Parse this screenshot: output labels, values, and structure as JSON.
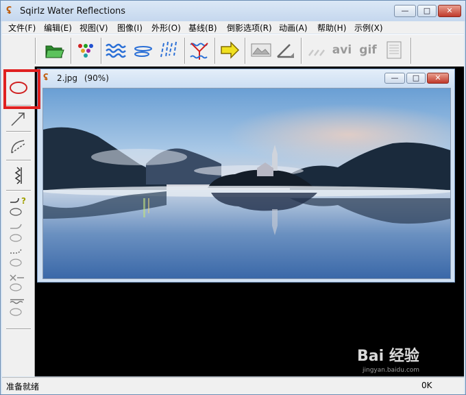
{
  "window": {
    "title": "Sqirlz Water Reflections",
    "minimize_glyph": "—",
    "maximize_glyph": "□",
    "close_glyph": "✕"
  },
  "menu": [
    {
      "label": "文件(F)"
    },
    {
      "label": "编辑(E)"
    },
    {
      "label": "视图(V)"
    },
    {
      "label": "图像(I)"
    },
    {
      "label": "外形(O)"
    },
    {
      "label": "基线(B)"
    },
    {
      "label": "倒影选项(R)"
    },
    {
      "label": "动画(A)"
    },
    {
      "label": "帮助(H)"
    },
    {
      "label": "示例(X)"
    }
  ],
  "toolbar": {
    "avi_label": "avi",
    "gif_label": "gif"
  },
  "document": {
    "title": "2.jpg",
    "zoom": "(90%)"
  },
  "status": {
    "text": "准备就绪",
    "right": "0K"
  },
  "watermark": {
    "brand": "Bai 经验",
    "url": "jingyan.baidu.com"
  },
  "colors": {
    "highlight": "#e02020",
    "accent_blue": "#3a78d0"
  }
}
